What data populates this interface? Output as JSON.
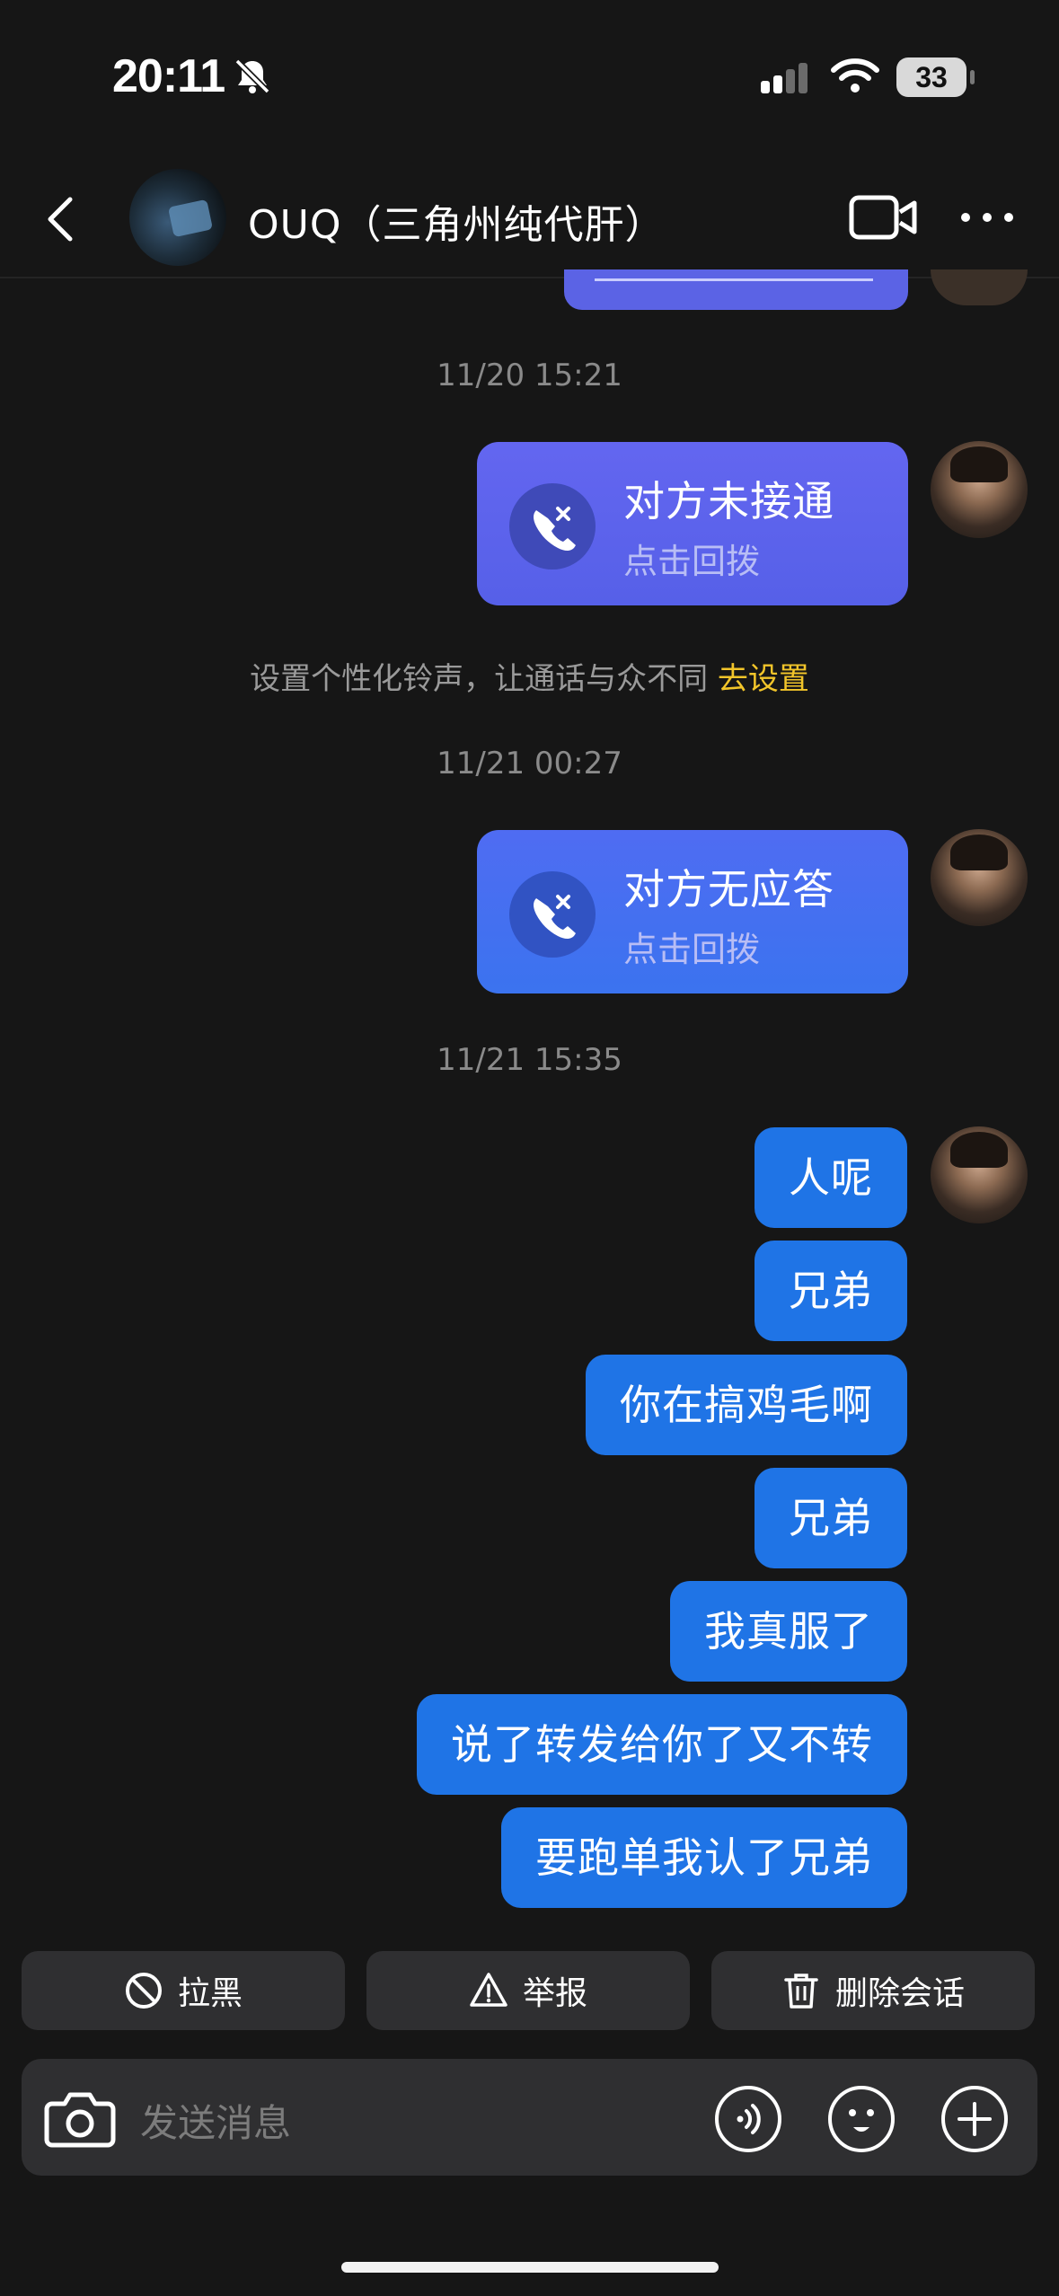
{
  "status_bar": {
    "time": "20:11",
    "battery": "33"
  },
  "header": {
    "contact_name": "OUQ（三角州纯代肝）"
  },
  "messages": {
    "timestamps": [
      "11/20 15:21",
      "11/21 00:27",
      "11/21 15:35"
    ],
    "call_1": {
      "title": "对方未接通",
      "subtitle": "点击回拨"
    },
    "hint": {
      "text": "设置个性化铃声，让通话与众不同",
      "link": "去设置"
    },
    "call_2": {
      "title": "对方无应答",
      "subtitle": "点击回拨"
    },
    "texts": [
      "人呢",
      "兄弟",
      "你在搞鸡毛啊",
      "兄弟",
      "我真服了",
      "说了转发给你了又不转",
      "要跑单我认了兄弟"
    ]
  },
  "actions": {
    "block": "拉黑",
    "report": "举报",
    "delete": "删除会话"
  },
  "input": {
    "placeholder": "发送消息"
  },
  "colors": {
    "background": "#161616",
    "bubble_blue": "#1f74e6",
    "call_bubble": "#5b63e5",
    "link_yellow": "#f2c52a"
  }
}
